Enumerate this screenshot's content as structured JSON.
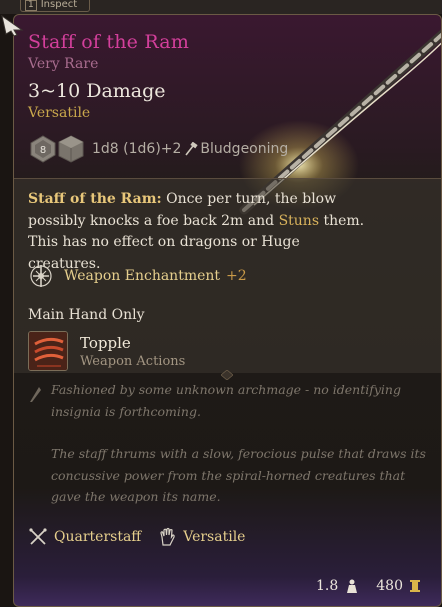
{
  "topbar": {
    "key": "1",
    "label": "Inspect"
  },
  "item": {
    "name": "Staff of the Ram",
    "rarity": "Very Rare",
    "damage": "3~10 Damage",
    "property": "Versatile",
    "dice": {
      "die1": "8",
      "formula": "1d8 (1d6)+2",
      "damage_type": "Bludgeoning"
    },
    "description": {
      "name": "Staff of the Ram:",
      "before_stun": " Once per turn, the blow possibly knocks a foe back 2m and ",
      "stun": "Stuns",
      "after_stun": " them. This has no effect on dragons or Huge creatures."
    },
    "enchantment": {
      "label": "Weapon Enchantment",
      "bonus": "+2"
    },
    "hand": "Main Hand Only",
    "action": {
      "name": "Topple",
      "category": "Weapon Actions"
    },
    "lore": [
      "Fashioned by some unknown archmage - no identifying insignia is forthcoming.",
      "The staff thrums with a slow, ferocious pulse that draws its concussive power from the spiral-horned creatures that gave the weapon its name."
    ],
    "tags": [
      {
        "label": "Quarterstaff",
        "icon": "crossed-staves-icon"
      },
      {
        "label": "Versatile",
        "icon": "open-hand-icon"
      }
    ],
    "weight": "1.8",
    "price": "480"
  },
  "colors": {
    "title": "#d33f9b",
    "rarity": "#a86c8e",
    "gold": "#e6cf8d",
    "lore": "#7e766b"
  }
}
